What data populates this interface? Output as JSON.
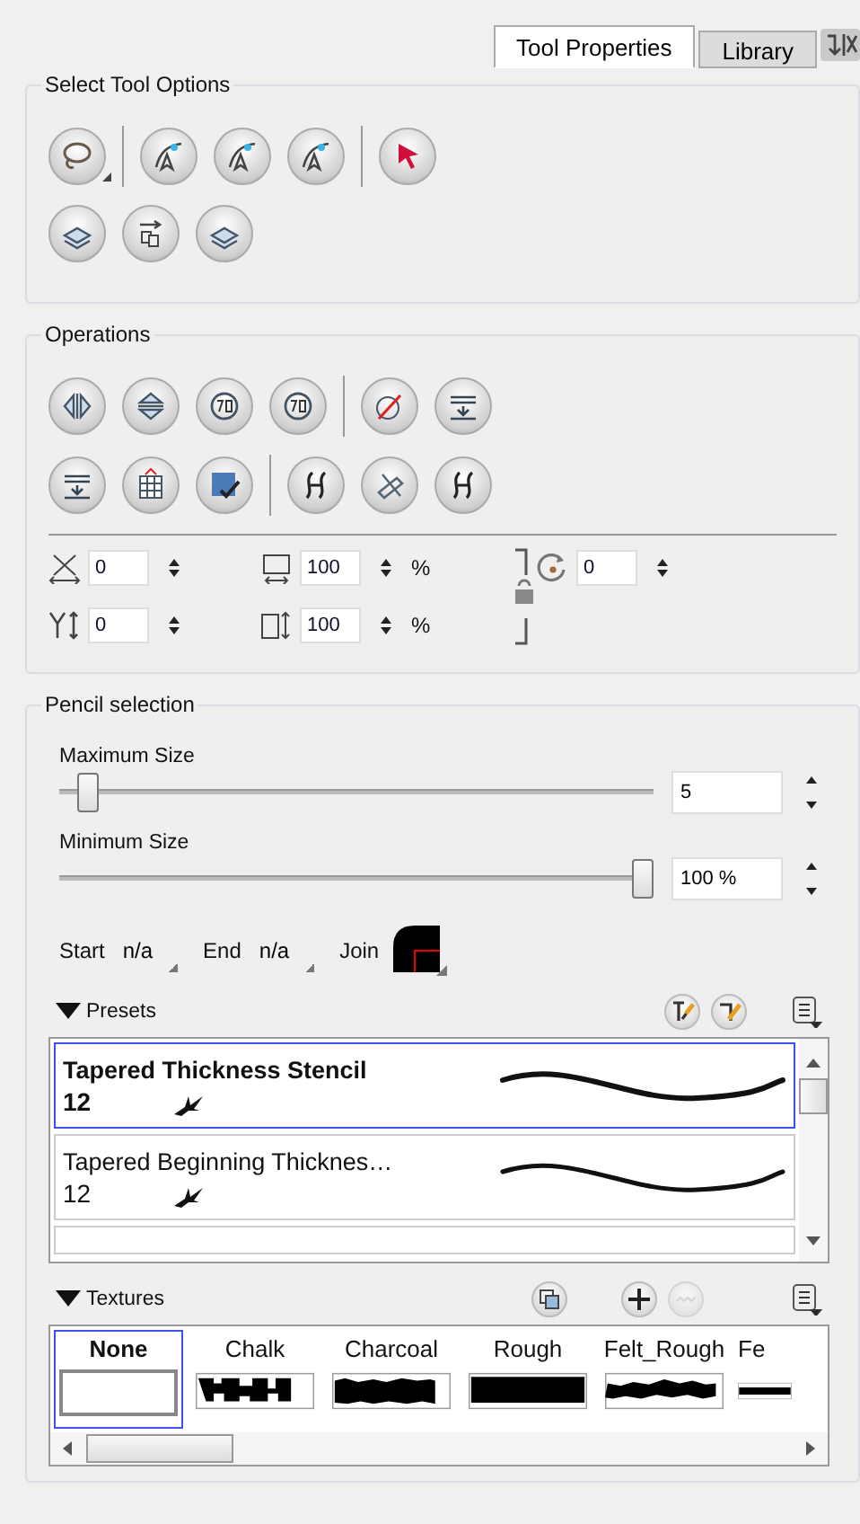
{
  "tabs": [
    {
      "label": "Tool Properties",
      "selected": true
    },
    {
      "label": "Library",
      "selected": false
    }
  ],
  "select_tool_options": {
    "title": "Select Tool Options"
  },
  "operations": {
    "title": "Operations",
    "fields": [
      {
        "kind": "x",
        "value": "0"
      },
      {
        "kind": "width",
        "value": "100",
        "unit": "%"
      },
      {
        "kind": "angle",
        "value": "0"
      },
      {
        "kind": "y",
        "value": "0"
      },
      {
        "kind": "height",
        "value": "100",
        "unit": "%"
      }
    ]
  },
  "pencil_selection": {
    "title": "Pencil selection",
    "sliders": [
      {
        "label": "Maximum Size",
        "level": 0.03,
        "value": "5"
      },
      {
        "label": "Minimum Size",
        "level": 1,
        "value": "100 %"
      }
    ],
    "start_label": "Start",
    "start_value": "n/a",
    "end_label": "End",
    "end_value": "n/a",
    "join_label": "Join",
    "presets": {
      "title": "Presets",
      "items": [
        {
          "name": "Tapered Thickness Stencil",
          "size": "12",
          "selected": true
        },
        {
          "name": "Tapered Beginning Thicknes…",
          "size": "12",
          "selected": false
        }
      ]
    },
    "textures": {
      "title": "Textures",
      "items": [
        {
          "name": "None",
          "kind": "empty",
          "selected": true
        },
        {
          "name": "Chalk",
          "kind": "chalk",
          "selected": false
        },
        {
          "name": "Charcoal",
          "kind": "charcoal",
          "selected": false
        },
        {
          "name": "Rough",
          "kind": "rough",
          "selected": false
        },
        {
          "name": "Felt_Rough",
          "kind": "felt",
          "selected": false
        },
        {
          "name": "Fe",
          "kind": "soft",
          "selected": false
        }
      ]
    }
  }
}
